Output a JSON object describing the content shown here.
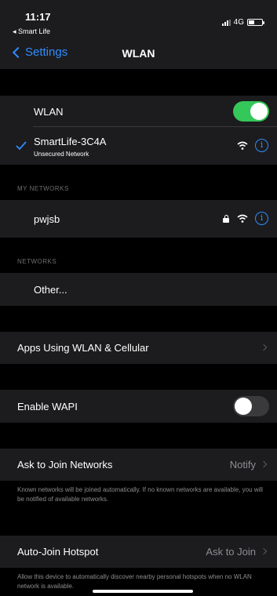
{
  "status": {
    "time": "11:17",
    "back_app": "◂ Smart Life",
    "network": "4G"
  },
  "nav": {
    "back_label": "Settings",
    "title": "WLAN"
  },
  "wlan": {
    "label": "WLAN",
    "enabled": true
  },
  "current": {
    "ssid": "SmartLife-3C4A",
    "subtitle": "Unsecured Network"
  },
  "my_networks": {
    "header": "MY NETWORKS",
    "items": [
      {
        "ssid": "pwjsb",
        "secured": true
      }
    ]
  },
  "networks": {
    "header": "NETWORKS",
    "other_label": "Other..."
  },
  "apps_using": {
    "label": "Apps Using WLAN & Cellular"
  },
  "wapi": {
    "label": "Enable WAPI",
    "enabled": false
  },
  "ask_join": {
    "label": "Ask to Join Networks",
    "value": "Notify",
    "footer": "Known networks will be joined automatically. If no known networks are available, you will be notified of available networks."
  },
  "auto_join": {
    "label": "Auto-Join Hotspot",
    "value": "Ask to Join",
    "footer": "Allow this device to automatically discover nearby personal hotspots when no WLAN network is available."
  },
  "colors": {
    "accent": "#2f8cff",
    "toggle_on": "#34c759",
    "toggle_off": "#3a3a3c",
    "cell_bg": "#1c1c1e",
    "bg": "#000000"
  }
}
